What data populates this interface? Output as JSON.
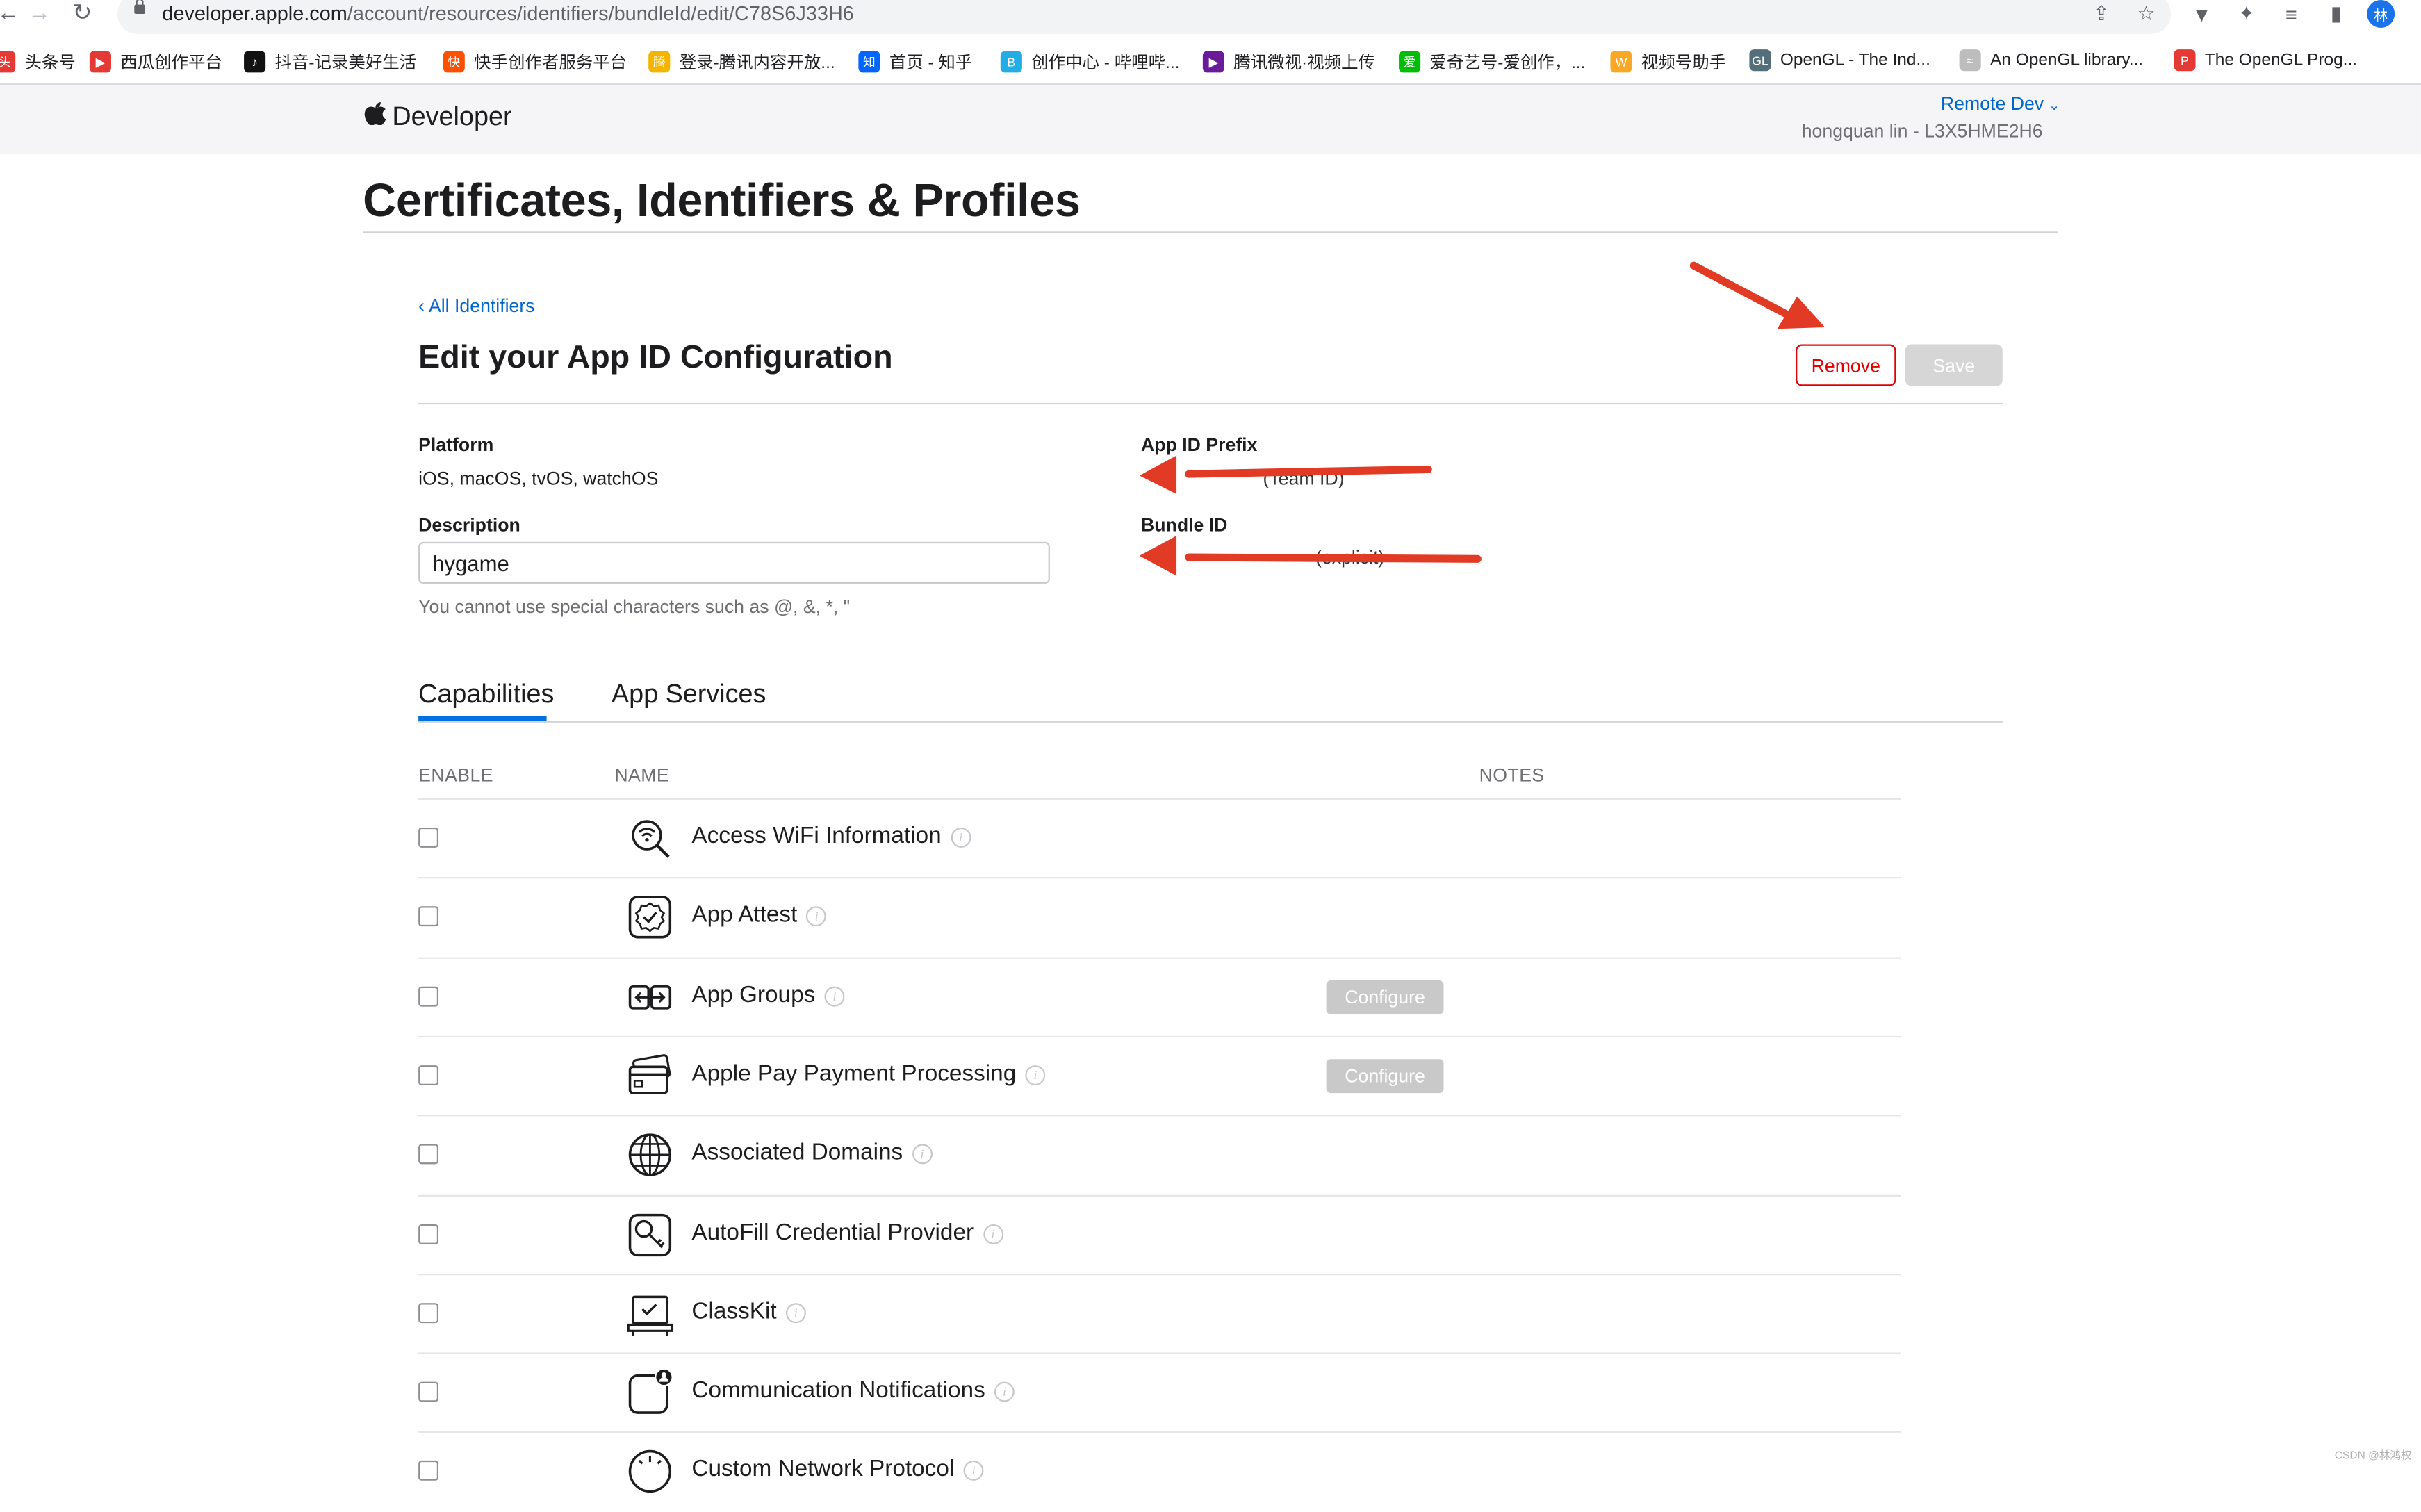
{
  "browser": {
    "url_host": "developer.apple.com",
    "url_path": "/account/resources/identifiers/bundleId/edit/C78S6J33H6",
    "profile_initial": "林",
    "bookmarks": [
      {
        "label": "头条号",
        "color": "#e53935",
        "glyph": "头"
      },
      {
        "label": "西瓜创作平台",
        "color": "#e53935",
        "glyph": "▶"
      },
      {
        "label": "抖音-记录美好生活",
        "color": "#111111",
        "glyph": "♪"
      },
      {
        "label": "快手创作者服务平台",
        "color": "#ff5000",
        "glyph": "快"
      },
      {
        "label": "登录-腾讯内容开放...",
        "color": "#f4b400",
        "glyph": "腾"
      },
      {
        "label": "首页 - 知乎",
        "color": "#0066ff",
        "glyph": "知"
      },
      {
        "label": "创作中心 - 哔哩哔...",
        "color": "#23ade5",
        "glyph": "B"
      },
      {
        "label": "腾讯微视·视频上传",
        "color": "#6a1b9a",
        "glyph": "▶"
      },
      {
        "label": "爱奇艺号-爱创作，...",
        "color": "#00be06",
        "glyph": "爱"
      },
      {
        "label": "视频号助手",
        "color": "#f9a825",
        "glyph": "W"
      },
      {
        "label": "OpenGL - The Ind...",
        "color": "#546e7a",
        "glyph": "GL"
      },
      {
        "label": "An OpenGL library...",
        "color": "#bdbdbd",
        "glyph": "≈"
      },
      {
        "label": "The OpenGL Prog...",
        "color": "#e53935",
        "glyph": "P"
      }
    ]
  },
  "header": {
    "brand": "Developer",
    "team_menu": "Remote Dev",
    "user": "hongquan lin - L3X5HME2H6"
  },
  "page_title": "Certificates, Identifiers & Profiles",
  "back_link": "All Identifiers",
  "section_title": "Edit your App ID Configuration",
  "buttons": {
    "remove": "Remove",
    "save": "Save"
  },
  "fields": {
    "platform_label": "Platform",
    "platform_value": "iOS, macOS, tvOS, watchOS",
    "description_label": "Description",
    "description_value": "hygame",
    "description_hint": "You cannot use special characters such as @, &, *, \"",
    "prefix_label": "App ID Prefix",
    "prefix_value_partial": "(Team ID)",
    "bundle_label": "Bundle ID",
    "bundle_value_partial": "(explicit)"
  },
  "tabs": [
    {
      "label": "Capabilities",
      "active": true
    },
    {
      "label": "App Services",
      "active": false
    }
  ],
  "table": {
    "headers": {
      "enable": "ENABLE",
      "name": "NAME",
      "notes": "NOTES"
    },
    "configure_label": "Configure",
    "rows": [
      {
        "name": "Access WiFi Information",
        "icon": "wifi-search-icon",
        "configure": false
      },
      {
        "name": "App Attest",
        "icon": "attest-badge-icon",
        "configure": false
      },
      {
        "name": "App Groups",
        "icon": "app-groups-icon",
        "configure": true
      },
      {
        "name": "Apple Pay Payment Processing",
        "icon": "credit-card-icon",
        "configure": true
      },
      {
        "name": "Associated Domains",
        "icon": "globe-icon",
        "configure": false
      },
      {
        "name": "AutoFill Credential Provider",
        "icon": "key-icon",
        "configure": false
      },
      {
        "name": "ClassKit",
        "icon": "classkit-icon",
        "configure": false
      },
      {
        "name": "Communication Notifications",
        "icon": "communication-notifications-icon",
        "configure": false
      },
      {
        "name": "Custom Network Protocol",
        "icon": "network-protocol-icon",
        "configure": false
      }
    ]
  },
  "annotation_color": "#e23b25",
  "watermark": "CSDN @林鸿权"
}
